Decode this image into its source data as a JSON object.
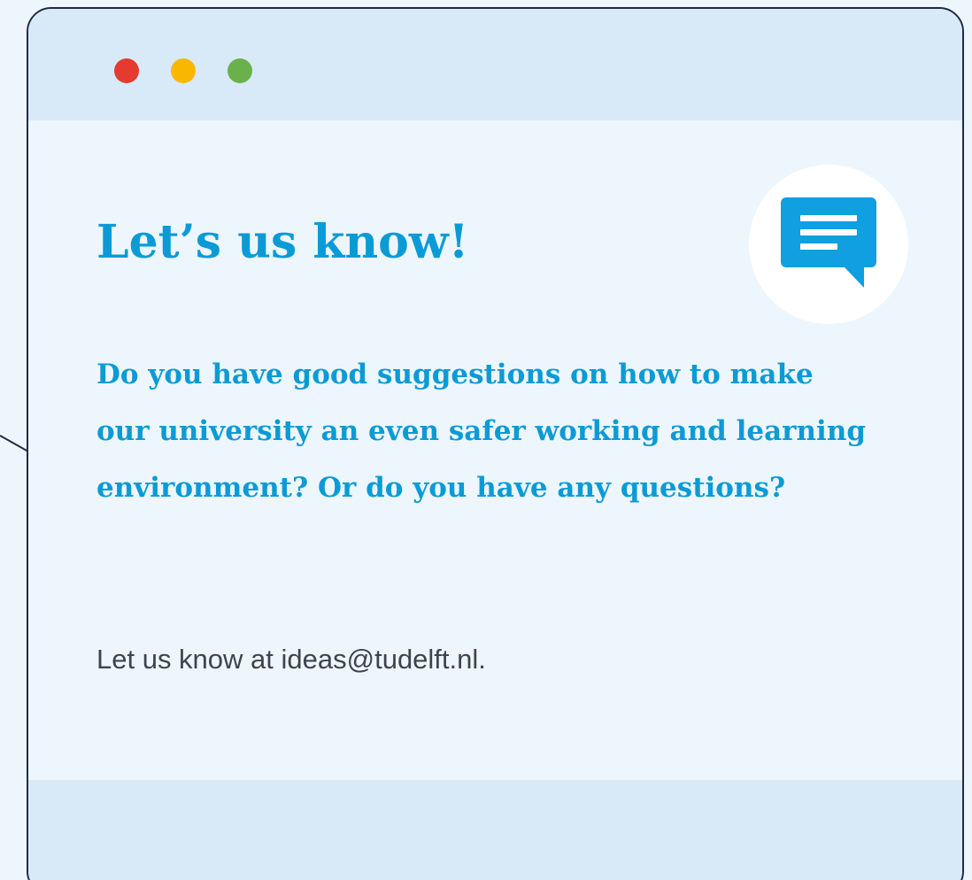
{
  "window": {
    "controls": [
      {
        "name": "close",
        "color": "#e53a2f"
      },
      {
        "name": "minimize",
        "color": "#fbb600"
      },
      {
        "name": "maximize",
        "color": "#6ab04c"
      }
    ]
  },
  "card": {
    "heading": "Let’s us know!",
    "question": "Do you have good suggestions on how to make our university an even safer working and learning environment? Or do you have any questions?",
    "contact": "Let us know at ideas@tudelft.nl.",
    "icon": "chat-bubble-icon"
  },
  "colors": {
    "accent": "#0a9bd6",
    "icon": "#109fe0",
    "titlebar": "#d8e9f8",
    "body": "#eef6fd",
    "border": "#1f2a44",
    "text": "#3d4450"
  }
}
